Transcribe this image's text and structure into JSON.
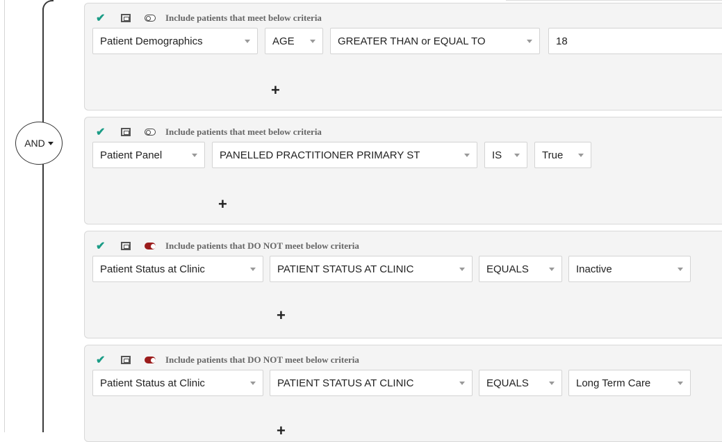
{
  "group": {
    "operator_label": "AND"
  },
  "blocks": [
    {
      "header": "Include patients that meet below criteria",
      "negated": false,
      "fields": [
        "Patient Demographics",
        "AGE",
        "GREATER THAN or EQUAL TO",
        "18"
      ]
    },
    {
      "header": "Include patients that meet below criteria",
      "negated": false,
      "fields": [
        "Patient Panel",
        "PANELLED PRACTITIONER PRIMARY ST",
        "IS",
        "True"
      ]
    },
    {
      "header": "Include patients that DO NOT meet below criteria",
      "negated": true,
      "fields": [
        "Patient Status at Clinic",
        "PATIENT STATUS AT CLINIC",
        "EQUALS",
        "Inactive"
      ]
    },
    {
      "header": "Include patients that DO NOT meet below criteria",
      "negated": true,
      "fields": [
        "Patient Status at Clinic",
        "PATIENT STATUS AT CLINIC",
        "EQUALS",
        "Long Term Care"
      ]
    }
  ],
  "add_symbol": "+",
  "check_symbol": "✔",
  "colors": {
    "check": "#1a9c86",
    "negated_toggle": "#9b1c1c",
    "panel_bg": "#f4f4f4"
  }
}
